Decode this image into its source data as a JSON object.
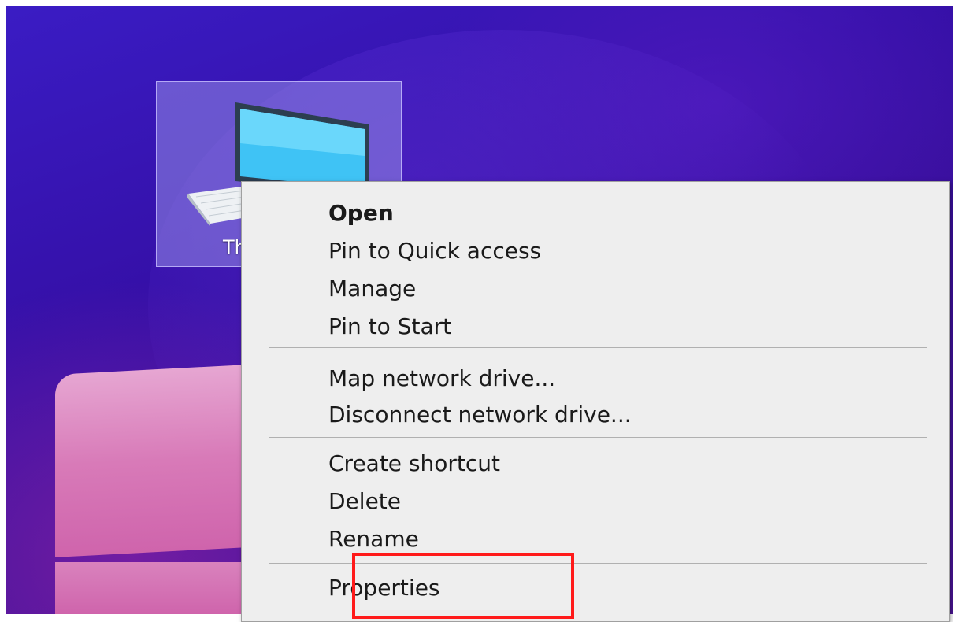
{
  "desktop": {
    "icon": {
      "name": "computer-icon",
      "label": "Th"
    }
  },
  "context_menu": {
    "sections": [
      [
        {
          "label": "Open",
          "bold": true
        },
        {
          "label": "Pin to Quick access"
        },
        {
          "label": "Manage"
        },
        {
          "label": "Pin to Start"
        }
      ],
      [
        {
          "label": "Map network drive..."
        },
        {
          "label": "Disconnect network drive..."
        }
      ],
      [
        {
          "label": "Create shortcut"
        },
        {
          "label": "Delete"
        },
        {
          "label": "Rename"
        }
      ],
      [
        {
          "label": "Properties"
        }
      ]
    ]
  },
  "annotation": {
    "highlight_color": "#ff1a1a",
    "highlighted_item": "Properties"
  }
}
